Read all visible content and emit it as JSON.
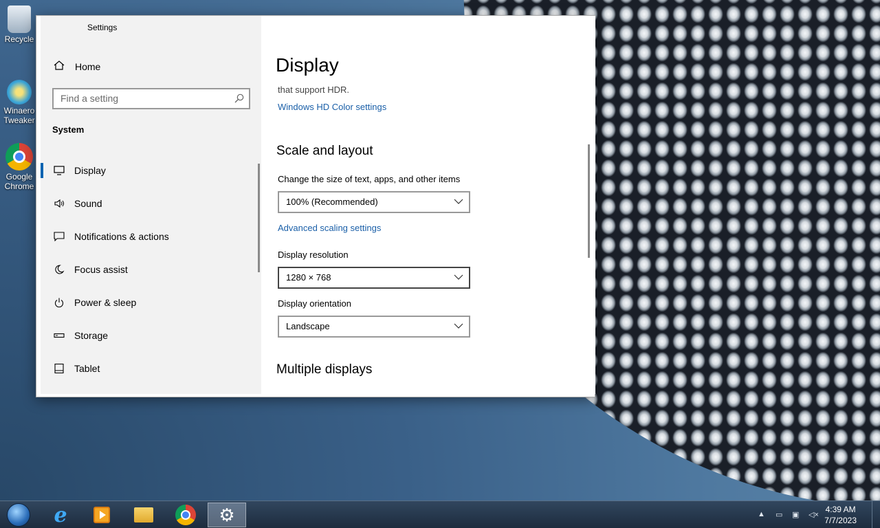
{
  "desktop": {
    "icons": [
      {
        "label": "Recycle",
        "name": "recycle-bin"
      },
      {
        "label": "Winaero Tweaker",
        "name": "winaero-tweaker"
      },
      {
        "label": "Google Chrome",
        "name": "google-chrome"
      }
    ]
  },
  "window": {
    "title": "Settings",
    "home_label": "Home",
    "search_placeholder": "Find a setting",
    "section_label": "System",
    "nav_items": [
      {
        "label": "Display",
        "icon": "monitor-icon",
        "selected": true
      },
      {
        "label": "Sound",
        "icon": "speaker-icon"
      },
      {
        "label": "Notifications & actions",
        "icon": "notification-icon"
      },
      {
        "label": "Focus assist",
        "icon": "moon-icon"
      },
      {
        "label": "Power & sleep",
        "icon": "power-icon"
      },
      {
        "label": "Storage",
        "icon": "storage-icon"
      },
      {
        "label": "Tablet",
        "icon": "tablet-icon"
      }
    ]
  },
  "main": {
    "title": "Display",
    "hdr_text": "that support HDR.",
    "hdr_link": "Windows HD Color settings",
    "scale_heading": "Scale and layout",
    "scale_label": "Change the size of text, apps, and other items",
    "scale_value": "100% (Recommended)",
    "advanced_link": "Advanced scaling settings",
    "resolution_label": "Display resolution",
    "resolution_value": "1280 × 768",
    "orientation_label": "Display orientation",
    "orientation_value": "Landscape",
    "multiple_heading": "Multiple displays"
  },
  "taskbar": {
    "apps": [
      "start-button",
      "internet-explorer",
      "media-player",
      "file-explorer",
      "chrome",
      "settings"
    ],
    "time": "4:39 AM",
    "date": "7/7/2023"
  },
  "colors": {
    "accent": "#0063b1",
    "link": "#1a5fa8"
  }
}
